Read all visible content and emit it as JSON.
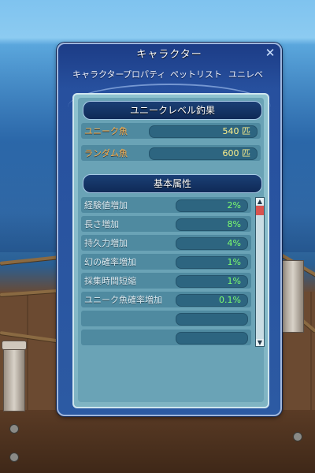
{
  "window": {
    "title": "キャラクター",
    "close_glyph": "✕",
    "tabs": [
      "キャラクター",
      "プロパティ",
      "ペットリスト",
      "ユニレベ"
    ]
  },
  "unique_level": {
    "header": "ユニークレベル釣果",
    "rows": [
      {
        "label": "ユニーク魚",
        "value": "540 匹"
      },
      {
        "label": "ランダム魚",
        "value": "600 匹"
      }
    ]
  },
  "basic_attributes": {
    "header": "基本属性",
    "rows": [
      {
        "label": "経験値増加",
        "value": "2%"
      },
      {
        "label": "長さ増加",
        "value": "8%"
      },
      {
        "label": "持久力増加",
        "value": "4%"
      },
      {
        "label": "幻の確率増加",
        "value": "1%"
      },
      {
        "label": "採集時間短縮",
        "value": "1%"
      },
      {
        "label": "ユニーク魚確率増加",
        "value": "0.1%"
      },
      {
        "label": "",
        "value": ""
      },
      {
        "label": "",
        "value": ""
      }
    ]
  },
  "scrollbar": {
    "up": "▲",
    "down": "▼"
  },
  "colors": {
    "fish_label": "#ffb04a",
    "fish_value": "#fff08a",
    "attr_value": "#7dff6e",
    "header_bg": "#1b3f75",
    "panel_bg": "#6aa3b6"
  }
}
